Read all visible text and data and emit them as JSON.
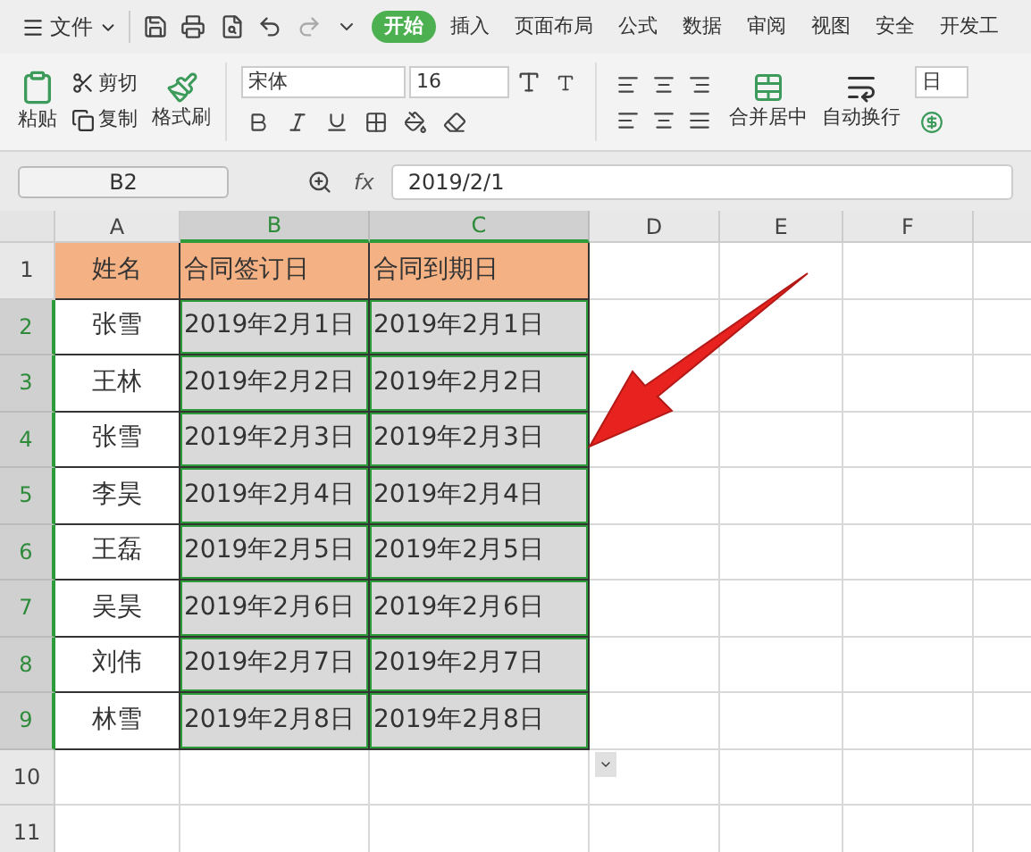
{
  "menu": {
    "file": "文件",
    "tabs": [
      {
        "label": "开始",
        "selected": true
      },
      {
        "label": "插入",
        "selected": false
      },
      {
        "label": "页面布局",
        "selected": false
      },
      {
        "label": "公式",
        "selected": false
      },
      {
        "label": "数据",
        "selected": false
      },
      {
        "label": "审阅",
        "selected": false
      },
      {
        "label": "视图",
        "selected": false
      },
      {
        "label": "安全",
        "selected": false
      },
      {
        "label": "开发工",
        "selected": false
      }
    ]
  },
  "ribbon": {
    "paste": "粘贴",
    "cut": "剪切",
    "copy": "复制",
    "format_painter": "格式刷",
    "font": "宋体",
    "font_size": "16",
    "merge": "合并居中",
    "wrap": "自动换行",
    "format_box": "日"
  },
  "formula_bar": {
    "cell_ref": "B2",
    "fx": "fx",
    "value": "2019/2/1"
  },
  "sheet": {
    "columns": [
      {
        "label": "A",
        "selected": false
      },
      {
        "label": "B",
        "selected": true
      },
      {
        "label": "C",
        "selected": true
      },
      {
        "label": "D",
        "selected": false
      },
      {
        "label": "E",
        "selected": false
      },
      {
        "label": "F",
        "selected": false
      }
    ],
    "rows": [
      {
        "number": "1",
        "selected": false,
        "kind": "header",
        "cells": [
          {
            "text": "姓名",
            "selected": false
          },
          {
            "text": "合同签订日",
            "selected": false
          },
          {
            "text": "合同到期日",
            "selected": false
          }
        ]
      },
      {
        "number": "2",
        "selected": true,
        "kind": "data",
        "cells": [
          {
            "text": "张雪",
            "selected": false
          },
          {
            "text": "2019年2月1日",
            "selected": true
          },
          {
            "text": "2019年2月1日",
            "selected": true
          }
        ]
      },
      {
        "number": "3",
        "selected": true,
        "kind": "data",
        "cells": [
          {
            "text": "王林",
            "selected": false
          },
          {
            "text": "2019年2月2日",
            "selected": true
          },
          {
            "text": "2019年2月2日",
            "selected": true
          }
        ]
      },
      {
        "number": "4",
        "selected": true,
        "kind": "data",
        "cells": [
          {
            "text": "张雪",
            "selected": false
          },
          {
            "text": "2019年2月3日",
            "selected": true
          },
          {
            "text": "2019年2月3日",
            "selected": true
          }
        ]
      },
      {
        "number": "5",
        "selected": true,
        "kind": "data",
        "cells": [
          {
            "text": "李昊",
            "selected": false
          },
          {
            "text": "2019年2月4日",
            "selected": true
          },
          {
            "text": "2019年2月4日",
            "selected": true
          }
        ]
      },
      {
        "number": "6",
        "selected": true,
        "kind": "data",
        "cells": [
          {
            "text": "王磊",
            "selected": false
          },
          {
            "text": "2019年2月5日",
            "selected": true
          },
          {
            "text": "2019年2月5日",
            "selected": true
          }
        ]
      },
      {
        "number": "7",
        "selected": true,
        "kind": "data",
        "cells": [
          {
            "text": "吴昊",
            "selected": false
          },
          {
            "text": "2019年2月6日",
            "selected": true
          },
          {
            "text": "2019年2月6日",
            "selected": true
          }
        ]
      },
      {
        "number": "8",
        "selected": true,
        "kind": "data",
        "cells": [
          {
            "text": "刘伟",
            "selected": false
          },
          {
            "text": "2019年2月7日",
            "selected": true
          },
          {
            "text": "2019年2月7日",
            "selected": true
          }
        ]
      },
      {
        "number": "9",
        "selected": true,
        "kind": "data",
        "cells": [
          {
            "text": "林雪",
            "selected": false
          },
          {
            "text": "2019年2月8日",
            "selected": true
          },
          {
            "text": "2019年2月8日",
            "selected": true
          }
        ]
      },
      {
        "number": "10",
        "selected": false,
        "kind": "empty"
      },
      {
        "number": "11",
        "selected": false,
        "kind": "empty"
      }
    ]
  }
}
